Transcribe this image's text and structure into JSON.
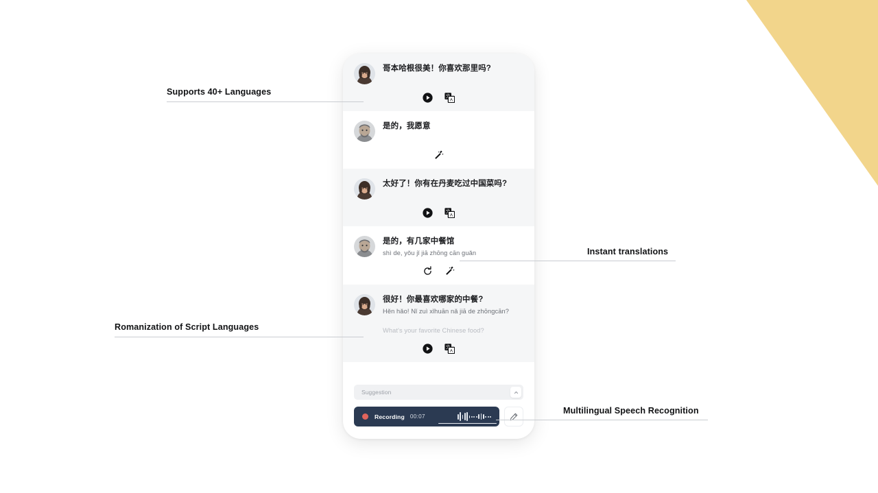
{
  "decor": {
    "triangle_color": "#f2d58b"
  },
  "callouts": [
    {
      "id": "supports-languages",
      "label": "Supports 40+ Languages"
    },
    {
      "id": "romanization",
      "label": "Romanization of Script Languages"
    },
    {
      "id": "instant-translations",
      "label": "Instant translations"
    },
    {
      "id": "speech-recognition",
      "label": "Multilingual Speech Recognition"
    }
  ],
  "phone": {
    "messages": [
      {
        "speaker": "woman",
        "shaded": true,
        "text": "哥本哈根很美！你喜欢那里吗?",
        "romanization": "",
        "gloss": "",
        "actions": [
          "play-icon",
          "translate-icon"
        ]
      },
      {
        "speaker": "man",
        "shaded": false,
        "text": "是的，我愿意",
        "romanization": "",
        "gloss": "",
        "actions": [
          "magic-wand-icon"
        ]
      },
      {
        "speaker": "woman",
        "shaded": true,
        "text": "太好了！你有在丹麦吃过中国菜吗?",
        "romanization": "",
        "gloss": "",
        "actions": [
          "play-icon",
          "translate-icon"
        ]
      },
      {
        "speaker": "man",
        "shaded": false,
        "text": "是的，有几家中餐馆",
        "romanization": "shì de, yǒu jǐ jiā zhōng cān guǎn",
        "gloss": "",
        "actions": [
          "refresh-icon",
          "magic-wand-icon"
        ]
      },
      {
        "speaker": "woman",
        "shaded": true,
        "text": "很好！你最喜欢哪家的中餐?",
        "romanization": "Hěn hǎo! Nǐ zuì xǐhuān nǎ jiā de zhōngcān?",
        "gloss": "What's your favorite Chinese food?",
        "actions": [
          "play-icon",
          "translate-icon"
        ]
      }
    ],
    "suggestion": {
      "label": "Suggestion",
      "toggle_icon": "chevron-up-icon"
    },
    "recorder": {
      "status": "Recording",
      "time": "00:07",
      "dot_color": "#e0645c",
      "bar_color": "#2b3a52",
      "edit_icon": "pencil-icon"
    }
  }
}
